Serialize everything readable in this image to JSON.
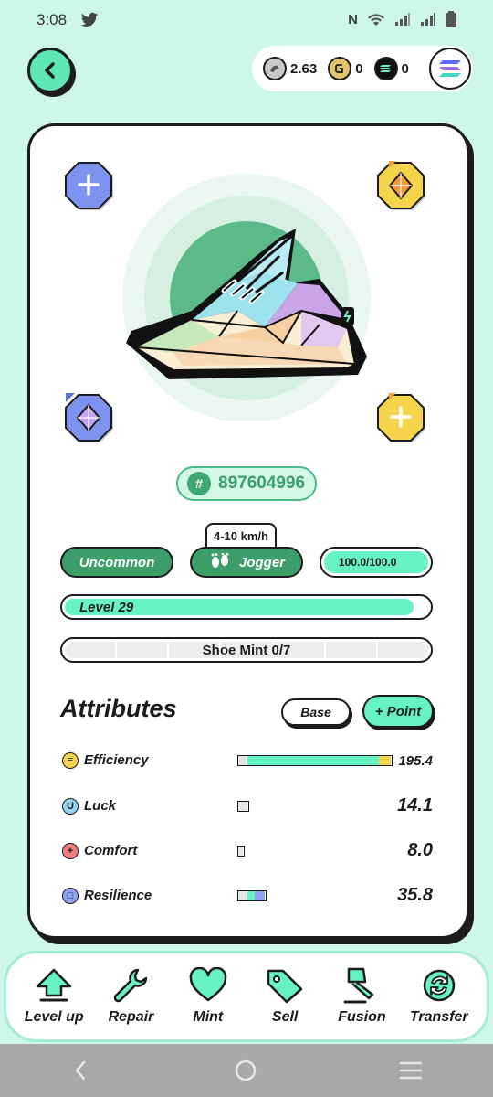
{
  "status_bar": {
    "time": "3:08"
  },
  "header": {
    "balances": [
      {
        "token": "gst",
        "value": "2.63",
        "icon": "gst-coin-icon"
      },
      {
        "token": "gmt",
        "value": "0",
        "icon": "gmt-coin-icon"
      },
      {
        "token": "sol",
        "value": "0",
        "icon": "sol-coin-icon"
      }
    ]
  },
  "sneaker": {
    "id_hash": "#",
    "id": "897604996",
    "rarity": "Uncommon",
    "speed_range": "4-10 km/h",
    "type": "Jogger",
    "durability": "100.0/100.0",
    "durability_fraction": 1.0,
    "level_label": "Level 29",
    "level_fraction": 0.96,
    "mint_label": "Shoe Mint 0/7",
    "mint_count": 0,
    "mint_max": 7
  },
  "attributes": {
    "title": "Attributes",
    "base_label": "Base",
    "point_label": "+ Point",
    "items": [
      {
        "name": "Efficiency",
        "icon_glyph": "≡",
        "value": "195.4",
        "color": "#f5d34a"
      },
      {
        "name": "Luck",
        "icon_glyph": "U",
        "value": "14.1",
        "color": "#8fd6f2"
      },
      {
        "name": "Comfort",
        "icon_glyph": "+",
        "value": "8.0",
        "color": "#f27e7e"
      },
      {
        "name": "Resilience",
        "icon_glyph": "□",
        "value": "35.8",
        "color": "#8fa3f2"
      }
    ]
  },
  "actions": [
    {
      "label": "Level up",
      "icon": "level-up-arrow-icon"
    },
    {
      "label": "Repair",
      "icon": "wrench-icon"
    },
    {
      "label": "Mint",
      "icon": "heart-icon"
    },
    {
      "label": "Sell",
      "icon": "price-tag-icon"
    },
    {
      "label": "Fusion",
      "icon": "hammer-icon"
    },
    {
      "label": "Transfer",
      "icon": "transfer-arrows-icon"
    }
  ],
  "colors": {
    "accent": "#66f2c4",
    "dark_green": "#3d9d6b",
    "background": "#cdf7e6"
  }
}
